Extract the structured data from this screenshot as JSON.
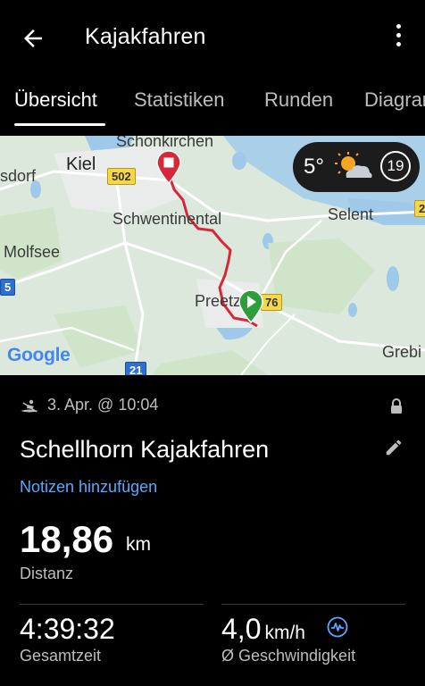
{
  "header": {
    "title": "Kajakfahren"
  },
  "tabs": [
    {
      "label": "Übersicht"
    },
    {
      "label": "Statistiken"
    },
    {
      "label": "Runden"
    },
    {
      "label": "Diagramme"
    }
  ],
  "map": {
    "labels": {
      "schonkirchen": "Schonkirchen",
      "kiel": "Kiel",
      "sdorf": "sdorf",
      "schwentinental": "Schwentinental",
      "selent": "Selent",
      "molfsee": "Molfsee",
      "preetz": "Preetz",
      "grebin": "Grebi"
    },
    "roads": {
      "r502": "502",
      "r76": "76",
      "r21": "21",
      "r5": "5",
      "r2": "2"
    },
    "attribution": "Google",
    "weather": {
      "temperature": "5°",
      "condition_icon": "partly-cloudy-sun-icon",
      "wind": "19"
    },
    "route_color": "#d6283b"
  },
  "activity": {
    "date": "3. Apr. @ 10:04",
    "name": "Schellhorn Kajakfahren",
    "notes_link": "Notizen hinzufügen",
    "distance": {
      "value": "18,86",
      "unit": "km",
      "label": "Distanz"
    },
    "total_time": {
      "value": "4:39:32",
      "label": "Gesamtzeit"
    },
    "avg_speed": {
      "value": "4,0",
      "unit": "km/h",
      "label": "Ø Geschwindigkeit"
    }
  },
  "colors": {
    "accent_link": "#5aa9ff",
    "start_marker": "#2e9e3b",
    "end_marker": "#d6283b"
  }
}
